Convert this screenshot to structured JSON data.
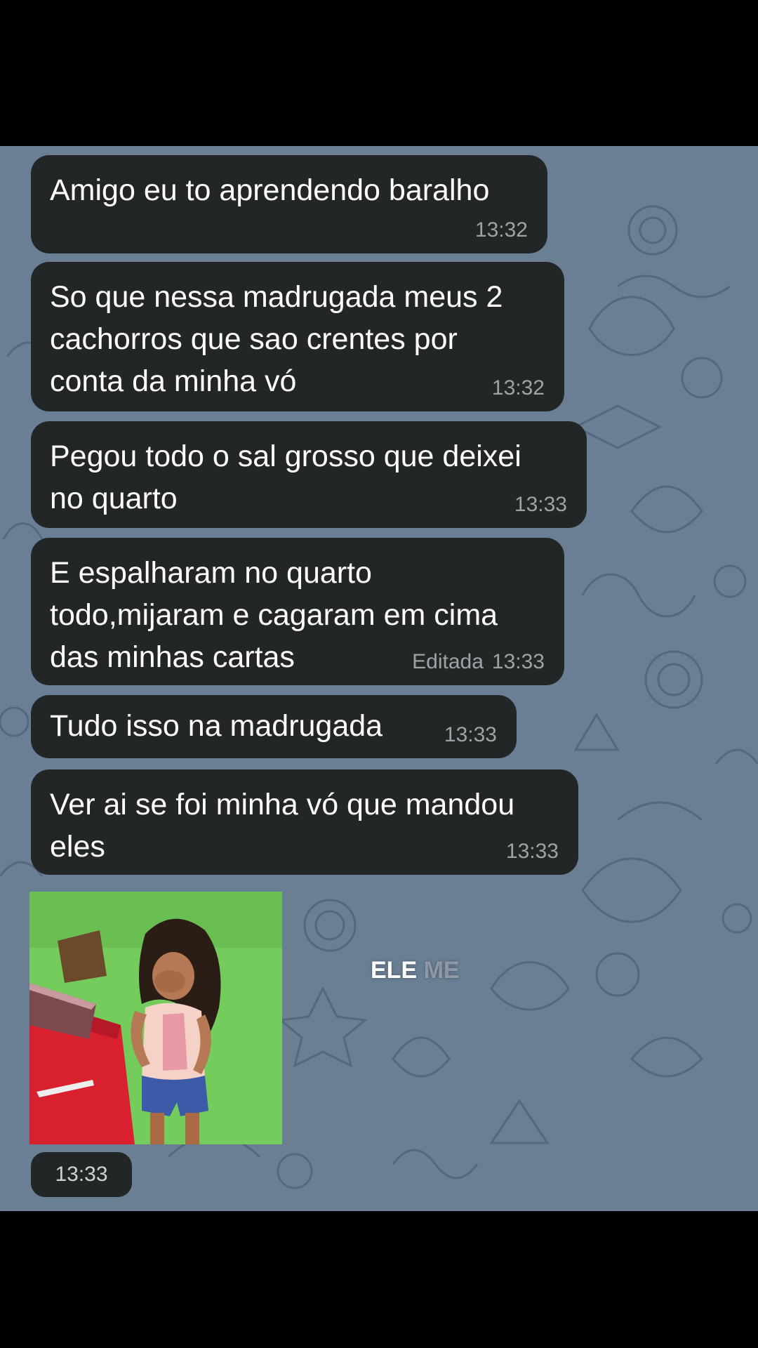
{
  "messages": [
    {
      "text": "Amigo eu to aprendendo baralho",
      "time": "13:32",
      "edited": ""
    },
    {
      "text": "So que nessa madrugada meus 2\ncachorros que sao crentes por\nconta da minha vó",
      "time": "13:32",
      "edited": ""
    },
    {
      "text": "Pegou todo o sal grosso que deixei\nno quarto",
      "time": "13:33",
      "edited": ""
    },
    {
      "text": "E espalharam no quarto\ntodo,mijaram e cagaram em cima\ndas minhas cartas",
      "time": "13:33",
      "edited": "Editada"
    },
    {
      "text": "Tudo isso na madrugada",
      "time": "13:33",
      "edited": ""
    },
    {
      "text": "Ver ai se foi minha vó que mandou\neles",
      "time": "13:33",
      "edited": ""
    }
  ],
  "sticker": {
    "caption_visible": "ELE",
    "caption_faded": "ME",
    "time": "13:33"
  },
  "colors": {
    "wallpaper": "#6a7f94",
    "bubble": "#232627",
    "sticker_bg": "#6fc85a"
  }
}
